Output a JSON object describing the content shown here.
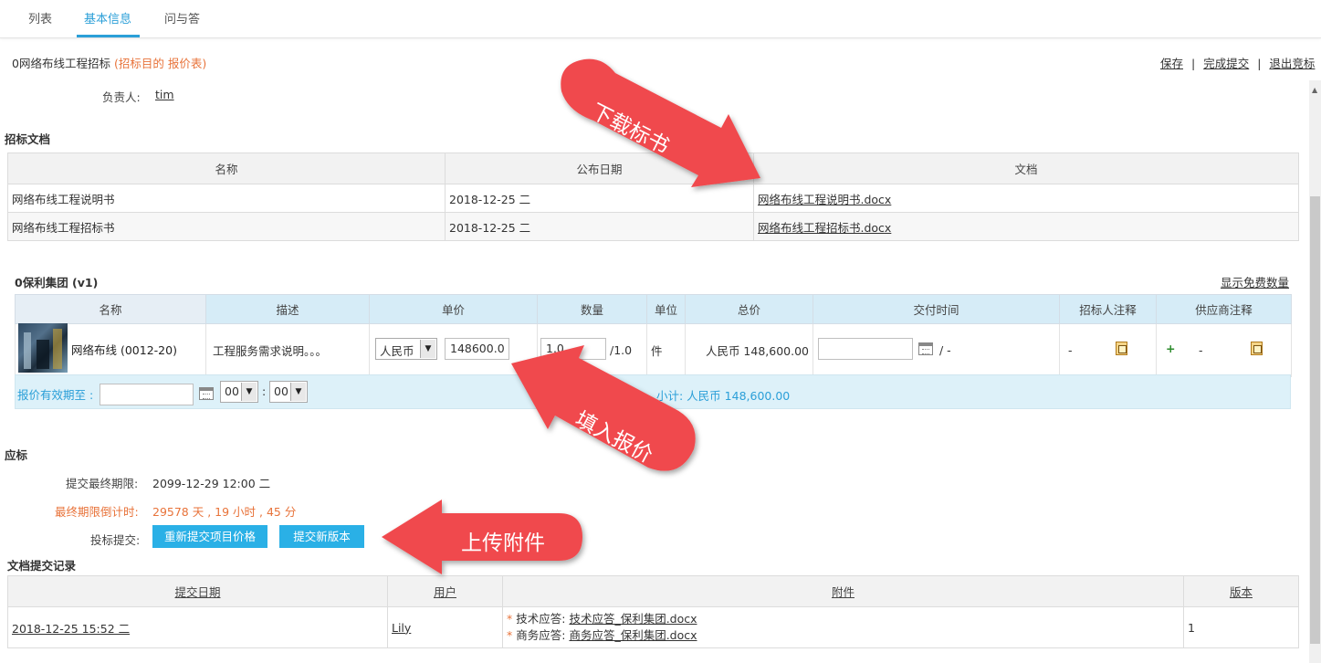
{
  "tabs": [
    {
      "label": "列表"
    },
    {
      "label": "基本信息"
    },
    {
      "label": "问与答"
    }
  ],
  "header": {
    "title": "0网络布线工程招标",
    "subtitle": "(招标目的 报价表)",
    "actions": {
      "save": "保存",
      "submit": "完成提交",
      "exit": "退出竞标"
    },
    "separator": "|"
  },
  "owner": {
    "label": "负责人:",
    "value": "tim"
  },
  "docs": {
    "title": "招标文档",
    "columns": [
      "名称",
      "公布日期",
      "文档"
    ],
    "rows": [
      {
        "name": "网络布线工程说明书",
        "date": "2018-12-25 二",
        "file": "网络布线工程说明书.docx"
      },
      {
        "name": "网络布线工程招标书",
        "date": "2018-12-25 二",
        "file": "网络布线工程招标书.docx"
      }
    ]
  },
  "quote": {
    "title": "0保利集团  (v1)",
    "show_free": "显示免费数量",
    "columns": [
      "名称",
      "描述",
      "单价",
      "数量",
      "单位",
      "总价",
      "交付时间",
      "招标人注释",
      "供应商注释"
    ],
    "row": {
      "name": "网络布线 (0012-20)",
      "desc": "工程服务需求说明。。。",
      "currency": "人民币",
      "price": "148600.0",
      "qty": "1.0",
      "qty_total": "/1.0",
      "unit": "件",
      "total": "人民币 148,600.00",
      "delivery_sep": "/ -",
      "buyer_note": "-",
      "supplier_plus": "+",
      "supplier_note": "-"
    },
    "valid_label": "报价有效期至 :",
    "hour": "00",
    "minute": "00",
    "colon": ":",
    "subtotal": "小计:  人民币 148,600.00"
  },
  "bid": {
    "title": "应标",
    "deadline_label": "提交最终期限:",
    "deadline_value": "2099-12-29 12:00 二",
    "countdown_label": "最终期限倒计时:",
    "countdown_value": "29578 天 , 19 小时 , 45 分",
    "submit_label": "投标提交:",
    "btn_resubmit": "重新提交项目价格",
    "btn_new_version": "提交新版本"
  },
  "history": {
    "title": "文档提交记录",
    "columns": [
      "提交日期",
      "用户",
      "附件",
      "版本"
    ],
    "rows": [
      {
        "date": "2018-12-25 15:52 二",
        "user": "Lily",
        "att1_label": "技术应答:",
        "att1_file": "技术应答_保利集团.docx",
        "att2_label": "商务应答:",
        "att2_file": "商务应答_保利集团.docx",
        "version": "1"
      }
    ]
  },
  "annotations": {
    "download": "下载标书",
    "fill": "填入报价",
    "upload": "上传附件",
    "color": "#f04a4e"
  },
  "colors": {
    "accent": "#2b9fd8",
    "orange": "#e8733a",
    "button": "#2ab0e6"
  }
}
